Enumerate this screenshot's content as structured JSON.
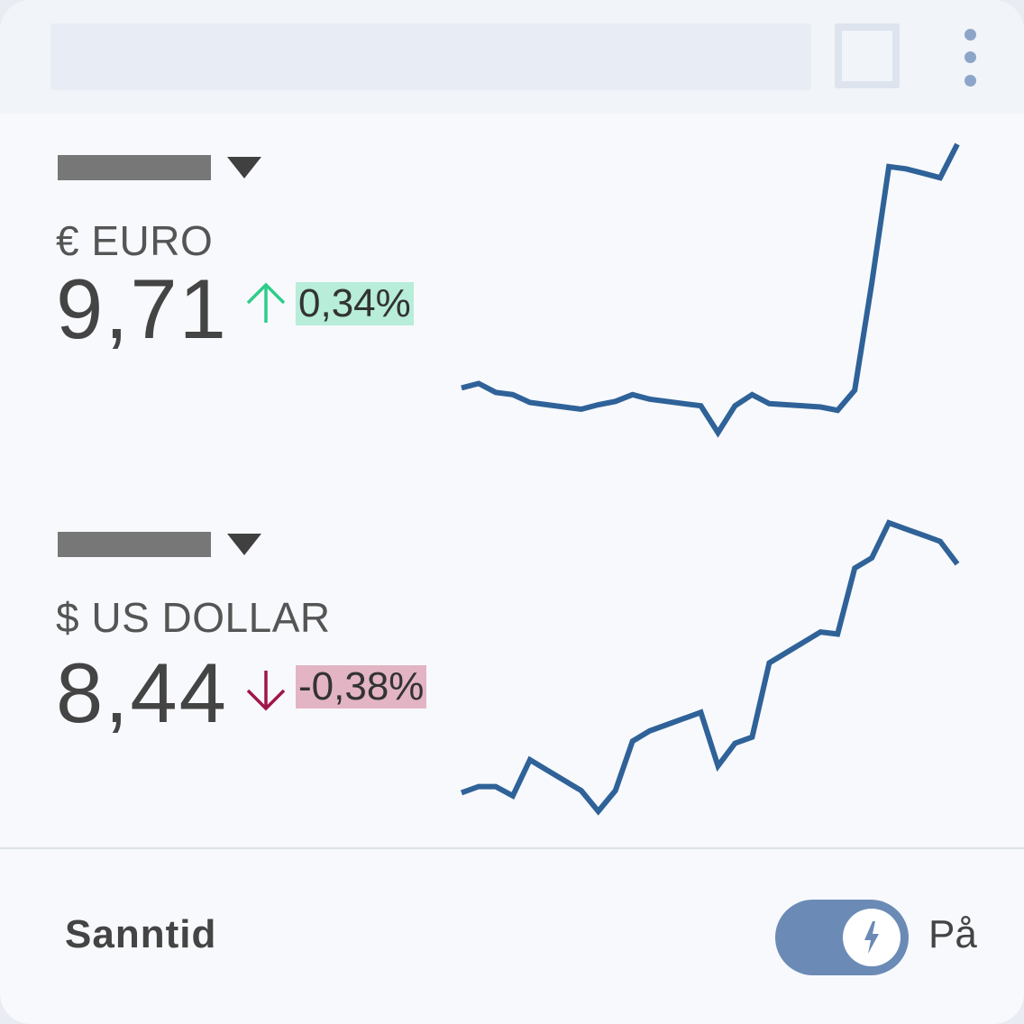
{
  "currencies": [
    {
      "name": "€ EURO",
      "value": "9,71",
      "change": "0,34%",
      "direction": "up",
      "change_color": "#2ecc8a",
      "change_bg": "#b7edd9"
    },
    {
      "name": "$ US DOLLAR",
      "value": "8,44",
      "change": "-0,38%",
      "direction": "down",
      "change_color": "#a0154a",
      "change_bg": "#e3b4c4"
    }
  ],
  "chart_data": [
    {
      "type": "line",
      "series": [
        {
          "values": [
            6.2,
            6.6,
            5.8,
            5.6,
            4.9,
            4.7,
            4.5,
            4.3,
            4.7,
            5.0,
            5.6,
            5.2,
            5.0,
            4.8,
            4.6,
            2.2,
            4.6,
            5.6,
            4.8,
            4.7,
            4.6,
            4.5,
            4.2,
            6.0,
            15.6,
            26.0,
            25.8,
            25.4,
            25.0,
            28.0
          ]
        }
      ],
      "line_color": "#2f6298"
    },
    {
      "type": "line",
      "series": [
        {
          "values": [
            2.8,
            3.4,
            3.4,
            2.5,
            6.0,
            5.0,
            4.0,
            3.0,
            1.0,
            3.0,
            7.8,
            8.8,
            9.4,
            10.0,
            10.6,
            5.4,
            7.6,
            8.2,
            15.4,
            16.4,
            17.4,
            18.4,
            18.2,
            24.6,
            25.6,
            29.0,
            28.4,
            27.8,
            27.2,
            25.0
          ]
        }
      ],
      "line_color": "#2f6298"
    }
  ],
  "footer": {
    "label": "Sanntid",
    "toggle_state": "På",
    "toggle_icon": "lightning-bolt-icon",
    "toggle_color": "#6b8bb6"
  },
  "header": {
    "menu_icon": "more-vertical-icon"
  }
}
